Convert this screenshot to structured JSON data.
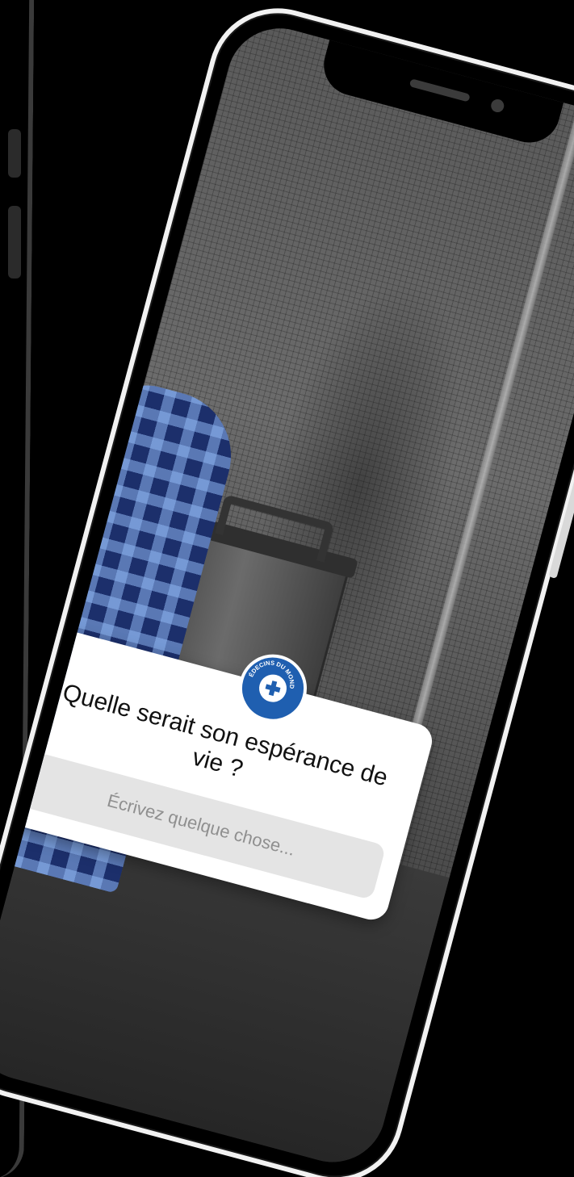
{
  "sticker": {
    "brand": "MÉDECINS DU MONDE",
    "question": "Quelle serait son espérance de vie ?",
    "answer_placeholder": "Écrivez quelque chose..."
  },
  "colors": {
    "background": "#000000",
    "phone_frame": "#f2f2f2",
    "sticker_bg": "#ffffff",
    "brand_blue": "#1f5fb0",
    "input_bg": "#e4e4e4",
    "placeholder_text": "#8f8f8f"
  },
  "icons": {
    "logo": "medecins-du-monde-logo"
  }
}
